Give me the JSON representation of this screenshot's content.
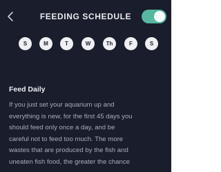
{
  "header": {
    "title": "FEEDING SCHEDULE",
    "back_icon": "chevron-left-icon",
    "toggle_on": true,
    "accent_color": "#56b8a0",
    "background_color": "#1a1d2b"
  },
  "days": [
    {
      "label": "S"
    },
    {
      "label": "M"
    },
    {
      "label": "T"
    },
    {
      "label": "W"
    },
    {
      "label": "Th"
    },
    {
      "label": "F"
    },
    {
      "label": "S"
    }
  ],
  "content": {
    "title": "Feed Daily",
    "body": "If you just set your aquarium up and\neverything is new, for the first 45 days you\nshould feed only once a day, and be\ncareful not to feed too much. The more\nwastes that are produced by the fish and\nuneaten fish food, the greater the chance"
  }
}
